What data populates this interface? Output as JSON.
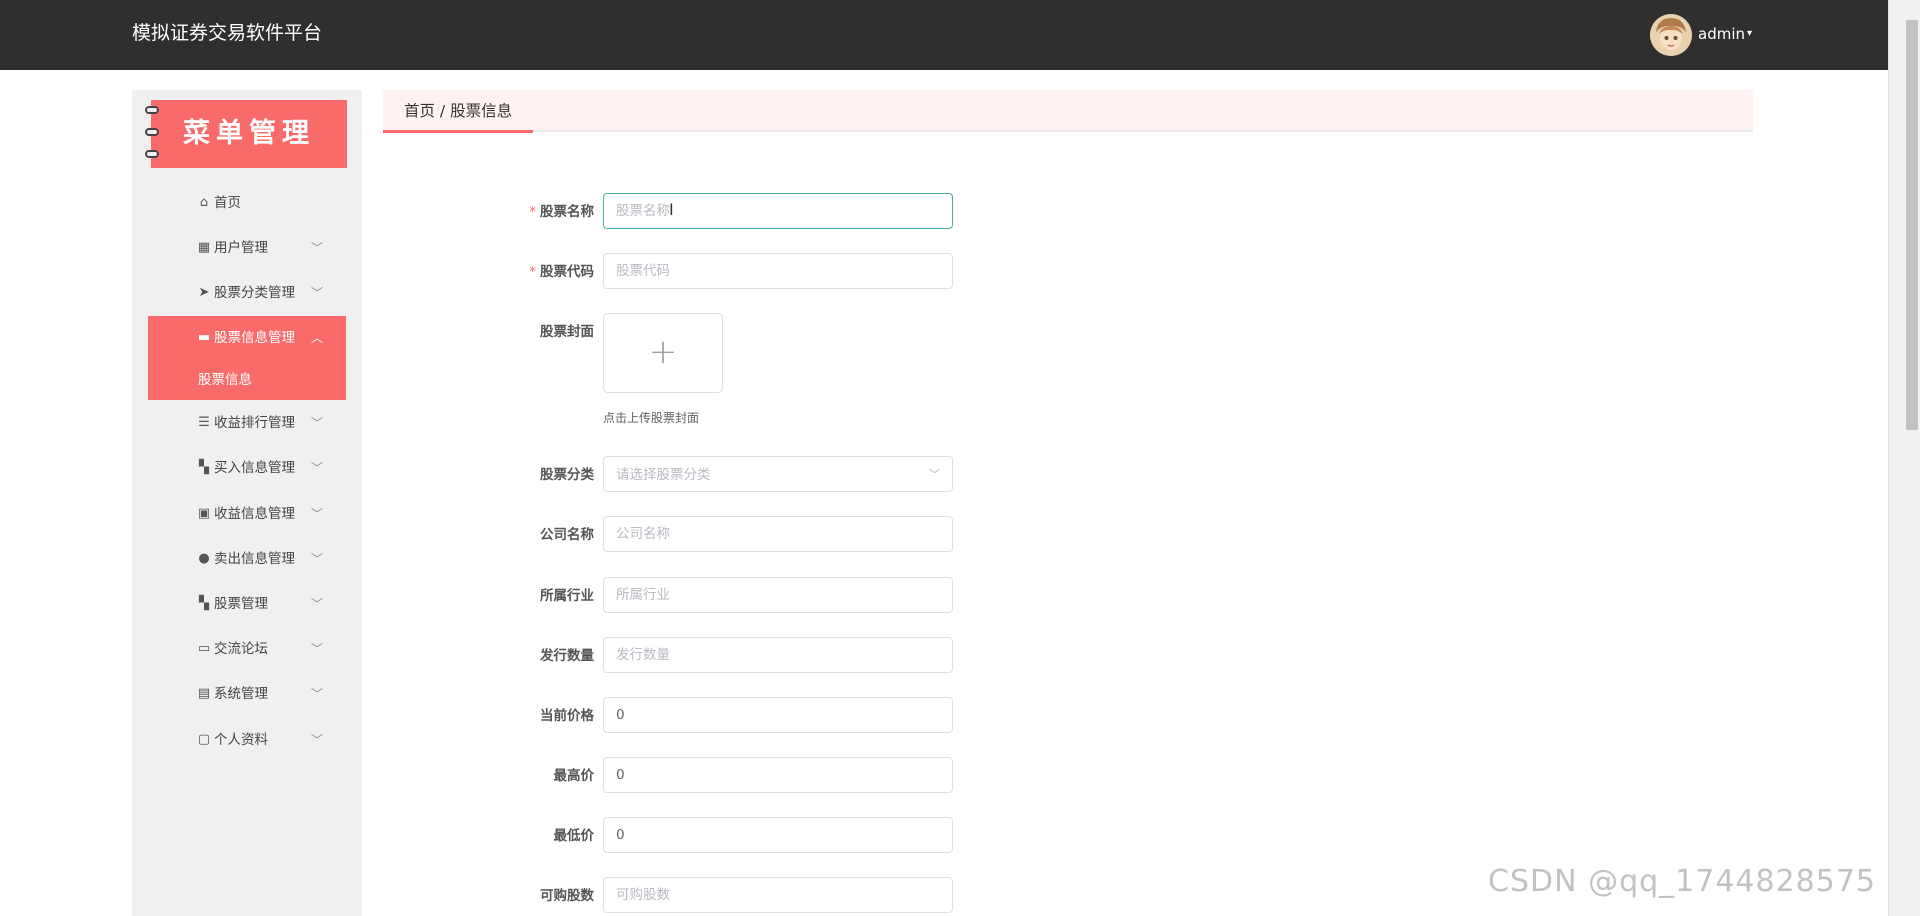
{
  "header": {
    "app_title": "模拟证券交易软件平台",
    "user_name": "admin",
    "user_caret": "▾"
  },
  "sidebar": {
    "banner_title": "菜单管理",
    "items": [
      {
        "label": "首页",
        "icon": "home-icon",
        "glyph": "⌂",
        "arrow": ""
      },
      {
        "label": "用户管理",
        "icon": "grid-icon",
        "glyph": "▦",
        "arrow": "﹀"
      },
      {
        "label": "股票分类管理",
        "icon": "paper-plane-icon",
        "glyph": "➤",
        "arrow": "﹀"
      },
      {
        "label": "股票信息管理",
        "icon": "inbox-icon",
        "glyph": "▬",
        "arrow": "︿"
      },
      {
        "label": "收益排行管理",
        "icon": "list-icon",
        "glyph": "☰",
        "arrow": "﹀"
      },
      {
        "label": "买入信息管理",
        "icon": "tiles-icon",
        "glyph": "▚",
        "arrow": "﹀"
      },
      {
        "label": "收益信息管理",
        "icon": "chart-icon",
        "glyph": "▣",
        "arrow": "﹀"
      },
      {
        "label": "卖出信息管理",
        "icon": "user-icon",
        "glyph": "●",
        "arrow": "﹀"
      },
      {
        "label": "股票管理",
        "icon": "tiles-icon",
        "glyph": "▚",
        "arrow": "﹀"
      },
      {
        "label": "交流论坛",
        "icon": "monitor-icon",
        "glyph": "▭",
        "arrow": "﹀"
      },
      {
        "label": "系统管理",
        "icon": "clipboard-icon",
        "glyph": "▤",
        "arrow": "﹀"
      },
      {
        "label": "个人资料",
        "icon": "card-icon",
        "glyph": "▢",
        "arrow": "﹀"
      }
    ],
    "active_submenu": "股票信息"
  },
  "breadcrumb": {
    "text": "首页 / 股票信息"
  },
  "form": {
    "name": {
      "label": "股票名称",
      "placeholder": "股票名称",
      "value": ""
    },
    "code": {
      "label": "股票代码",
      "placeholder": "股票代码",
      "value": ""
    },
    "cover": {
      "label": "股票封面",
      "plus": "+",
      "hint": "点击上传股票封面"
    },
    "category": {
      "label": "股票分类",
      "placeholder": "请选择股票分类",
      "arrow": "﹀"
    },
    "company": {
      "label": "公司名称",
      "placeholder": "公司名称",
      "value": ""
    },
    "industry": {
      "label": "所属行业",
      "placeholder": "所属行业",
      "value": ""
    },
    "issued": {
      "label": "发行数量",
      "placeholder": "发行数量",
      "value": ""
    },
    "price": {
      "label": "当前价格",
      "placeholder": "",
      "value": "0"
    },
    "high": {
      "label": "最高价",
      "placeholder": "",
      "value": "0"
    },
    "low": {
      "label": "最低价",
      "placeholder": "",
      "value": "0"
    },
    "buyable": {
      "label": "可购股数",
      "placeholder": "可购股数",
      "value": ""
    }
  },
  "watermark": "CSDN @qq_1744828575",
  "colors": {
    "accent": "#f96b6b",
    "topbar": "#2f2f2f",
    "focus": "#4cb0a6",
    "required": "#f56c6c"
  }
}
